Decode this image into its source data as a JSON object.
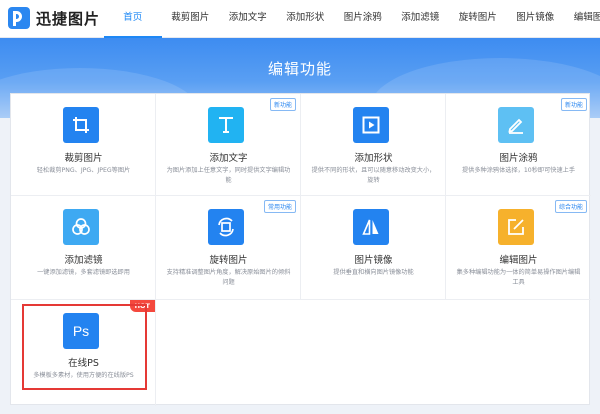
{
  "header": {
    "logo_text": "迅捷图片",
    "nav": [
      "首页",
      "裁剪图片",
      "添加文字",
      "添加形状",
      "图片涂鸦",
      "添加滤镜",
      "旋转图片",
      "图片镜像",
      "编辑图片"
    ]
  },
  "banner": {
    "title": "编辑功能"
  },
  "features": [
    {
      "title": "裁剪图片",
      "desc": "轻松裁剪PNG、JPG、JPEG等图片",
      "tag": "",
      "icon": "crop-icon",
      "color": "#2383f0"
    },
    {
      "title": "添加文字",
      "desc": "为图片添加上任意文字，同时提供文字编辑功能",
      "tag": "新功能",
      "icon": "text-icon",
      "color": "#21b3f2"
    },
    {
      "title": "添加形状",
      "desc": "提供不同的形状，且可以随意移动改变大小，旋转",
      "tag": "",
      "icon": "shape-icon",
      "color": "#2383f0"
    },
    {
      "title": "图片涂鸦",
      "desc": "提供多种涂鸦体选择，10秒即可快速上手",
      "tag": "新功能",
      "icon": "pen-icon",
      "color": "#5ec0f3"
    },
    {
      "title": "添加滤镜",
      "desc": "一键添加滤镜，多套滤镜即选即用",
      "tag": "",
      "icon": "filter-icon",
      "color": "#3ea9f2"
    },
    {
      "title": "旋转图片",
      "desc": "支持精准调整图片角度，解决原始图片的倾斜问题",
      "tag": "常用功能",
      "icon": "rotate-icon",
      "color": "#2383f0"
    },
    {
      "title": "图片镜像",
      "desc": "提供垂直和横向图片镜像功能",
      "tag": "",
      "icon": "mirror-icon",
      "color": "#2383f0"
    },
    {
      "title": "编辑图片",
      "desc": "集多种编辑功能为一体的简单易操作图片编辑工具",
      "tag": "综合功能",
      "icon": "edit-icon",
      "color": "#f6b12c"
    },
    {
      "title": "在线PS",
      "desc": "多模板多素材，使用方便的在线版PS",
      "tag": "HOT",
      "icon": "ps-icon",
      "icon_text": "Ps",
      "color": "#2383f0"
    }
  ]
}
